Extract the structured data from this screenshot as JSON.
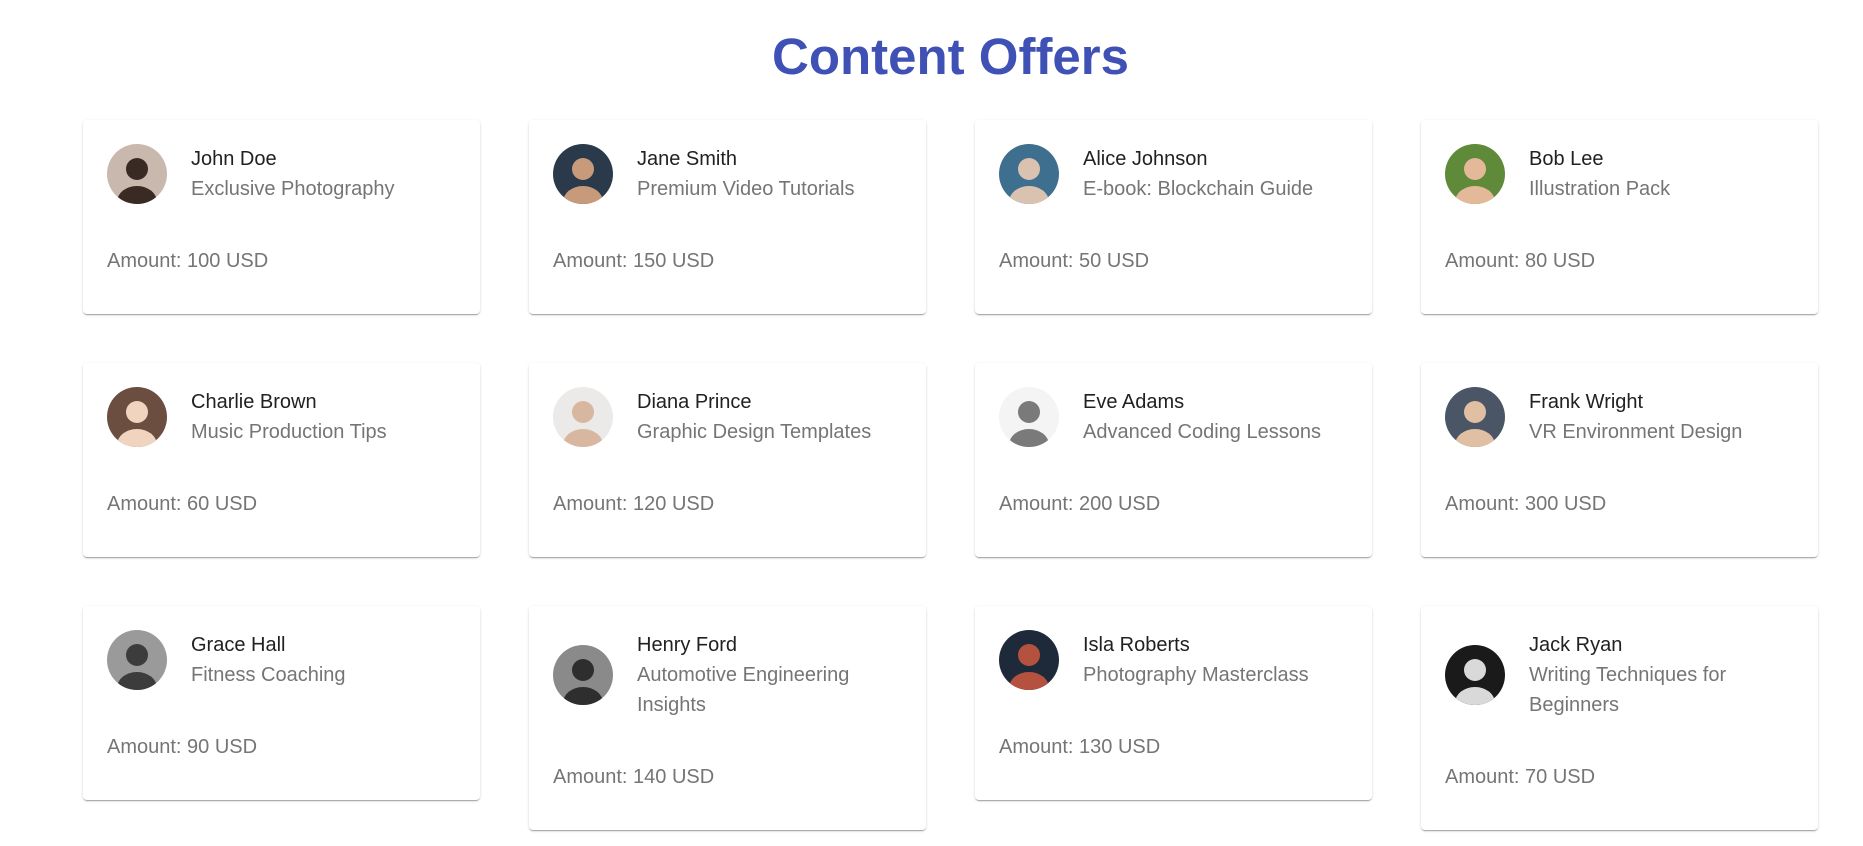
{
  "page": {
    "title": "Content Offers",
    "accent_color": "#3f51b5"
  },
  "offers": [
    {
      "name": "John Doe",
      "offer": "Exclusive Photography",
      "amount_label": "Amount: 100 USD",
      "avatar": "person-avatar-icon",
      "avatar_bg": "#c9b8ae",
      "avatar_fg": "#3a2a24"
    },
    {
      "name": "Jane Smith",
      "offer": "Premium Video Tutorials",
      "amount_label": "Amount: 150 USD",
      "avatar": "person-avatar-icon",
      "avatar_bg": "#2a3a4a",
      "avatar_fg": "#c79a7b"
    },
    {
      "name": "Alice Johnson",
      "offer": "E-book: Blockchain Guide",
      "amount_label": "Amount: 50 USD",
      "avatar": "person-avatar-icon",
      "avatar_bg": "#3f6f8f",
      "avatar_fg": "#d9c3b0"
    },
    {
      "name": "Bob Lee",
      "offer": "Illustration Pack",
      "amount_label": "Amount: 80 USD",
      "avatar": "person-avatar-icon",
      "avatar_bg": "#5e8a3a",
      "avatar_fg": "#e3b99a"
    },
    {
      "name": "Charlie Brown",
      "offer": "Music Production Tips",
      "amount_label": "Amount: 60 USD",
      "avatar": "person-avatar-icon",
      "avatar_bg": "#6b4e3f",
      "avatar_fg": "#f1d4c0"
    },
    {
      "name": "Diana Prince",
      "offer": "Graphic Design Templates",
      "amount_label": "Amount: 120 USD",
      "avatar": "person-avatar-icon",
      "avatar_bg": "#eceae8",
      "avatar_fg": "#d8b7a0"
    },
    {
      "name": "Eve Adams",
      "offer": "Advanced Coding Lessons",
      "amount_label": "Amount: 200 USD",
      "avatar": "person-avatar-icon",
      "avatar_bg": "#f4f4f4",
      "avatar_fg": "#7a7a7a"
    },
    {
      "name": "Frank Wright",
      "offer": "VR Environment Design",
      "amount_label": "Amount: 300 USD",
      "avatar": "person-avatar-icon",
      "avatar_bg": "#4a5566",
      "avatar_fg": "#e0bfa3"
    },
    {
      "name": "Grace Hall",
      "offer": "Fitness Coaching",
      "amount_label": "Amount: 90 USD",
      "avatar": "person-avatar-icon",
      "avatar_bg": "#9a9a9a",
      "avatar_fg": "#3c3c3c"
    },
    {
      "name": "Henry Ford",
      "offer": "Automotive Engineering Insights",
      "amount_label": "Amount: 140 USD",
      "avatar": "person-avatar-icon",
      "avatar_bg": "#8a8a8a",
      "avatar_fg": "#2e2e2e"
    },
    {
      "name": "Isla Roberts",
      "offer": "Photography Masterclass",
      "amount_label": "Amount: 130 USD",
      "avatar": "person-avatar-icon",
      "avatar_bg": "#1e2a3a",
      "avatar_fg": "#b5523f"
    },
    {
      "name": "Jack Ryan",
      "offer": "Writing Techniques for Beginners",
      "amount_label": "Amount: 70 USD",
      "avatar": "person-avatar-icon",
      "avatar_bg": "#1a1a1a",
      "avatar_fg": "#d9d9d9"
    }
  ]
}
